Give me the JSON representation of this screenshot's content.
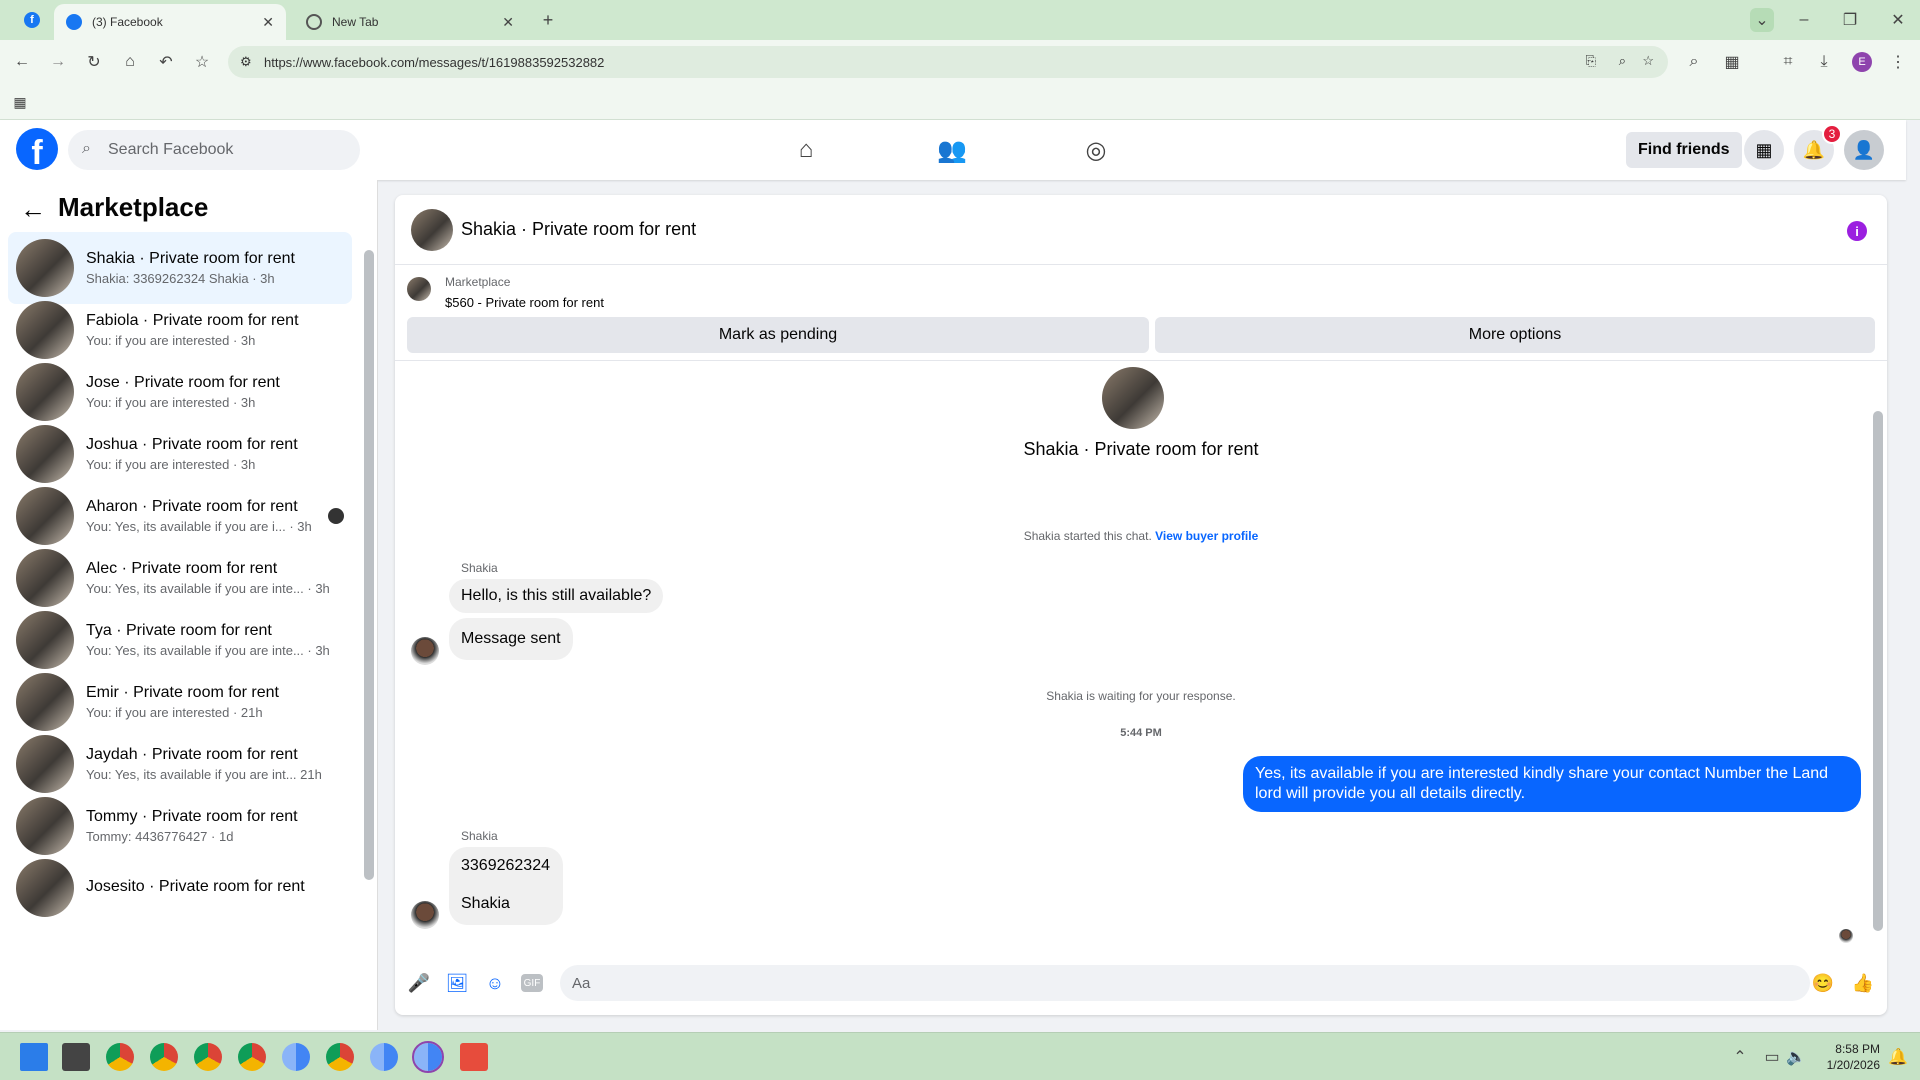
{
  "browser": {
    "tabs": [
      {
        "title": "(3) Facebook"
      },
      {
        "title": "New Tab"
      }
    ],
    "url": "https://www.facebook.com/messages/t/1619883592532882"
  },
  "header": {
    "search_placeholder": "Search Facebook",
    "find_friends": "Find friends",
    "notification_count": "3",
    "brand_color": "#0866ff"
  },
  "sidebar": {
    "title": "Marketplace",
    "conversations": [
      {
        "title": "Shakia · Private room for rent",
        "preview": "Shakia: 3369262324 Shakia · 3h"
      },
      {
        "title": "Fabiola · Private room for rent",
        "preview": "You: if you are interested · 3h"
      },
      {
        "title": "Jose · Private room for rent",
        "preview": "You: if you are interested · 3h"
      },
      {
        "title": "Joshua · Private room for rent",
        "preview": "You: if you are interested · 3h"
      },
      {
        "title": "Aharon · Private room for rent",
        "preview": "You: Yes, its available if you are i... · 3h"
      },
      {
        "title": "Alec · Private room for rent",
        "preview": "You: Yes, its available if you are inte... · 3h"
      },
      {
        "title": "Tya · Private room for rent",
        "preview": "You: Yes, its available if you are inte... · 3h"
      },
      {
        "title": "Emir · Private room for rent",
        "preview": "You: if you are interested · 21h"
      },
      {
        "title": "Jaydah · Private room for rent",
        "preview": "You: Yes, its available if you are int... 21h"
      },
      {
        "title": "Tommy · Private room for rent",
        "preview": "Tommy: 4436776427 · 1d"
      },
      {
        "title": "Josesito · Private room for rent",
        "preview": ""
      }
    ]
  },
  "chat": {
    "title": "Shakia · Private room for rent",
    "marketplace_label": "Marketplace",
    "listing": "$560 - Private room for rent",
    "mark_pending": "Mark as pending",
    "more_options": "More options",
    "profile_name": "Shakia · Private room for rent",
    "started_text": "Shakia started this chat.",
    "view_profile": "View buyer profile",
    "sender_name": "Shakia",
    "msg1": "Hello, is this still available?",
    "msg2": "Message sent",
    "waiting": "Shakia is waiting for your response.",
    "time": "5:44 PM",
    "my_msg": "Yes, its available if you are interested kindly share your contact Number the Land lord will provide you all details directly.",
    "sender_name2": "Shakia",
    "msg3a": "3369262324",
    "msg3b": "Shakia",
    "input_placeholder": "Aa"
  },
  "taskbar": {
    "time": "8:58 PM",
    "date": "1/20/2026"
  }
}
